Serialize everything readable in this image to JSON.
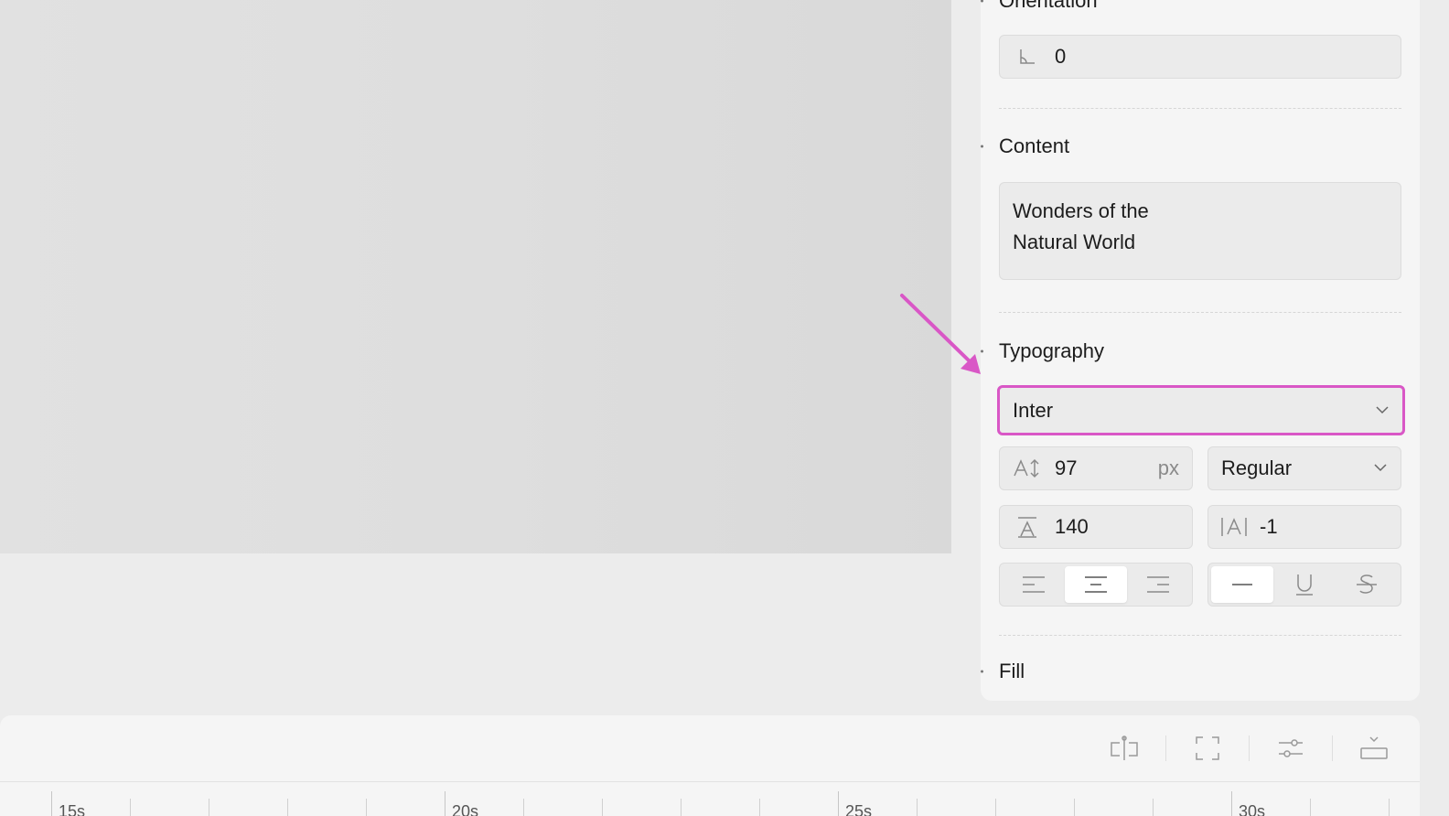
{
  "inspector": {
    "orientation": {
      "title": "Orientation",
      "value": "0"
    },
    "content": {
      "title": "Content",
      "text": "Wonders of the\nNatural World"
    },
    "typography": {
      "title": "Typography",
      "font_family": "Inter",
      "font_size": "97",
      "font_size_unit": "px",
      "font_weight": "Regular",
      "line_height": "140",
      "letter_spacing": "-1",
      "align_options": [
        "align-left",
        "align-center",
        "align-right"
      ],
      "align_selected": "align-center",
      "decoration_options": [
        "none",
        "underline",
        "strikethrough"
      ],
      "decoration_selected": "none"
    },
    "fill": {
      "title": "Fill"
    }
  },
  "timeline": {
    "tools": [
      "split-icon",
      "fit-frame-icon",
      "adjust-icon",
      "collapse-icon"
    ],
    "labels": [
      "15s",
      "20s",
      "25s",
      "30s"
    ]
  },
  "colors": {
    "focus_highlight": "#d957c6",
    "panel_bg": "#f5f5f5",
    "canvas_bg": "#dedede"
  }
}
